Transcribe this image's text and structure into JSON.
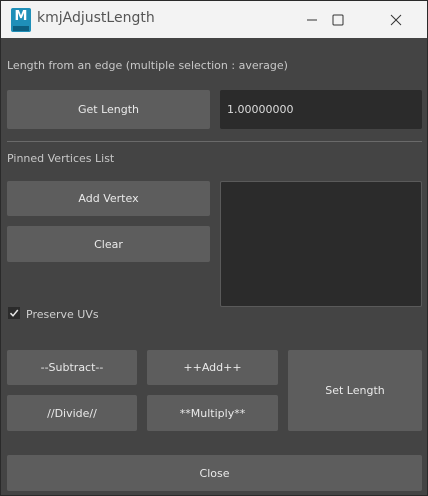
{
  "window": {
    "title": "kmjAdjustLength",
    "app_icon": "M"
  },
  "length_section": {
    "label": "Length from an edge (multiple selection : average)",
    "get_length_label": "Get Length",
    "length_value": "1.00000000"
  },
  "pinned_section": {
    "label": "Pinned Vertices List",
    "add_vertex_label": "Add Vertex",
    "clear_label": "Clear"
  },
  "preserve_uvs": {
    "label": "Preserve UVs",
    "checked": true
  },
  "operations": {
    "subtract_label": "--Subtract--",
    "add_label": "++Add++",
    "divide_label": "//Divide//",
    "multiply_label": "**Multiply**",
    "set_length_label": "Set Length"
  },
  "footer": {
    "close_label": "Close"
  }
}
